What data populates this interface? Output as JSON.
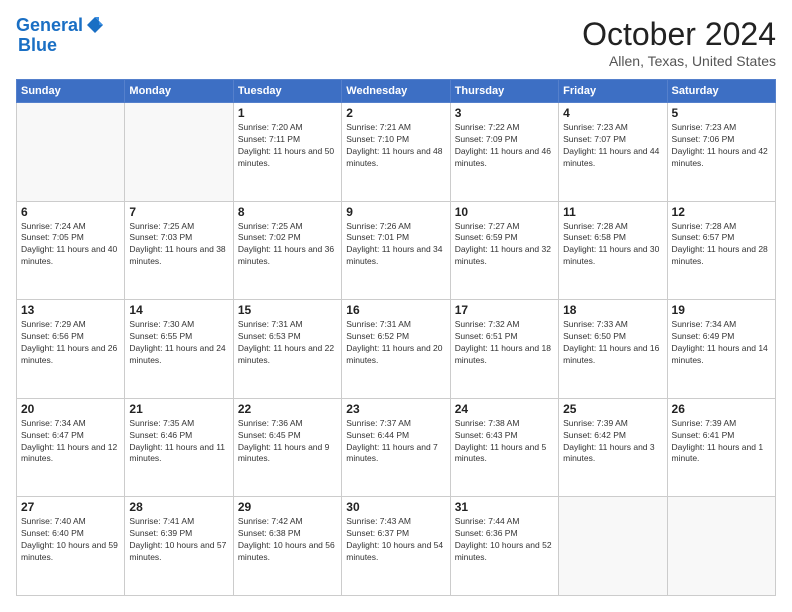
{
  "header": {
    "logo_line1": "General",
    "logo_line2": "Blue",
    "month_title": "October 2024",
    "location": "Allen, Texas, United States"
  },
  "weekdays": [
    "Sunday",
    "Monday",
    "Tuesday",
    "Wednesday",
    "Thursday",
    "Friday",
    "Saturday"
  ],
  "weeks": [
    [
      {
        "day": "",
        "empty": true
      },
      {
        "day": "",
        "empty": true
      },
      {
        "day": "1",
        "sunrise": "7:20 AM",
        "sunset": "7:11 PM",
        "daylight": "11 hours and 50 minutes."
      },
      {
        "day": "2",
        "sunrise": "7:21 AM",
        "sunset": "7:10 PM",
        "daylight": "11 hours and 48 minutes."
      },
      {
        "day": "3",
        "sunrise": "7:22 AM",
        "sunset": "7:09 PM",
        "daylight": "11 hours and 46 minutes."
      },
      {
        "day": "4",
        "sunrise": "7:23 AM",
        "sunset": "7:07 PM",
        "daylight": "11 hours and 44 minutes."
      },
      {
        "day": "5",
        "sunrise": "7:23 AM",
        "sunset": "7:06 PM",
        "daylight": "11 hours and 42 minutes."
      }
    ],
    [
      {
        "day": "6",
        "sunrise": "7:24 AM",
        "sunset": "7:05 PM",
        "daylight": "11 hours and 40 minutes."
      },
      {
        "day": "7",
        "sunrise": "7:25 AM",
        "sunset": "7:03 PM",
        "daylight": "11 hours and 38 minutes."
      },
      {
        "day": "8",
        "sunrise": "7:25 AM",
        "sunset": "7:02 PM",
        "daylight": "11 hours and 36 minutes."
      },
      {
        "day": "9",
        "sunrise": "7:26 AM",
        "sunset": "7:01 PM",
        "daylight": "11 hours and 34 minutes."
      },
      {
        "day": "10",
        "sunrise": "7:27 AM",
        "sunset": "6:59 PM",
        "daylight": "11 hours and 32 minutes."
      },
      {
        "day": "11",
        "sunrise": "7:28 AM",
        "sunset": "6:58 PM",
        "daylight": "11 hours and 30 minutes."
      },
      {
        "day": "12",
        "sunrise": "7:28 AM",
        "sunset": "6:57 PM",
        "daylight": "11 hours and 28 minutes."
      }
    ],
    [
      {
        "day": "13",
        "sunrise": "7:29 AM",
        "sunset": "6:56 PM",
        "daylight": "11 hours and 26 minutes."
      },
      {
        "day": "14",
        "sunrise": "7:30 AM",
        "sunset": "6:55 PM",
        "daylight": "11 hours and 24 minutes."
      },
      {
        "day": "15",
        "sunrise": "7:31 AM",
        "sunset": "6:53 PM",
        "daylight": "11 hours and 22 minutes."
      },
      {
        "day": "16",
        "sunrise": "7:31 AM",
        "sunset": "6:52 PM",
        "daylight": "11 hours and 20 minutes."
      },
      {
        "day": "17",
        "sunrise": "7:32 AM",
        "sunset": "6:51 PM",
        "daylight": "11 hours and 18 minutes."
      },
      {
        "day": "18",
        "sunrise": "7:33 AM",
        "sunset": "6:50 PM",
        "daylight": "11 hours and 16 minutes."
      },
      {
        "day": "19",
        "sunrise": "7:34 AM",
        "sunset": "6:49 PM",
        "daylight": "11 hours and 14 minutes."
      }
    ],
    [
      {
        "day": "20",
        "sunrise": "7:34 AM",
        "sunset": "6:47 PM",
        "daylight": "11 hours and 12 minutes."
      },
      {
        "day": "21",
        "sunrise": "7:35 AM",
        "sunset": "6:46 PM",
        "daylight": "11 hours and 11 minutes."
      },
      {
        "day": "22",
        "sunrise": "7:36 AM",
        "sunset": "6:45 PM",
        "daylight": "11 hours and 9 minutes."
      },
      {
        "day": "23",
        "sunrise": "7:37 AM",
        "sunset": "6:44 PM",
        "daylight": "11 hours and 7 minutes."
      },
      {
        "day": "24",
        "sunrise": "7:38 AM",
        "sunset": "6:43 PM",
        "daylight": "11 hours and 5 minutes."
      },
      {
        "day": "25",
        "sunrise": "7:39 AM",
        "sunset": "6:42 PM",
        "daylight": "11 hours and 3 minutes."
      },
      {
        "day": "26",
        "sunrise": "7:39 AM",
        "sunset": "6:41 PM",
        "daylight": "11 hours and 1 minute."
      }
    ],
    [
      {
        "day": "27",
        "sunrise": "7:40 AM",
        "sunset": "6:40 PM",
        "daylight": "10 hours and 59 minutes."
      },
      {
        "day": "28",
        "sunrise": "7:41 AM",
        "sunset": "6:39 PM",
        "daylight": "10 hours and 57 minutes."
      },
      {
        "day": "29",
        "sunrise": "7:42 AM",
        "sunset": "6:38 PM",
        "daylight": "10 hours and 56 minutes."
      },
      {
        "day": "30",
        "sunrise": "7:43 AM",
        "sunset": "6:37 PM",
        "daylight": "10 hours and 54 minutes."
      },
      {
        "day": "31",
        "sunrise": "7:44 AM",
        "sunset": "6:36 PM",
        "daylight": "10 hours and 52 minutes."
      },
      {
        "day": "",
        "empty": true
      },
      {
        "day": "",
        "empty": true
      }
    ]
  ]
}
